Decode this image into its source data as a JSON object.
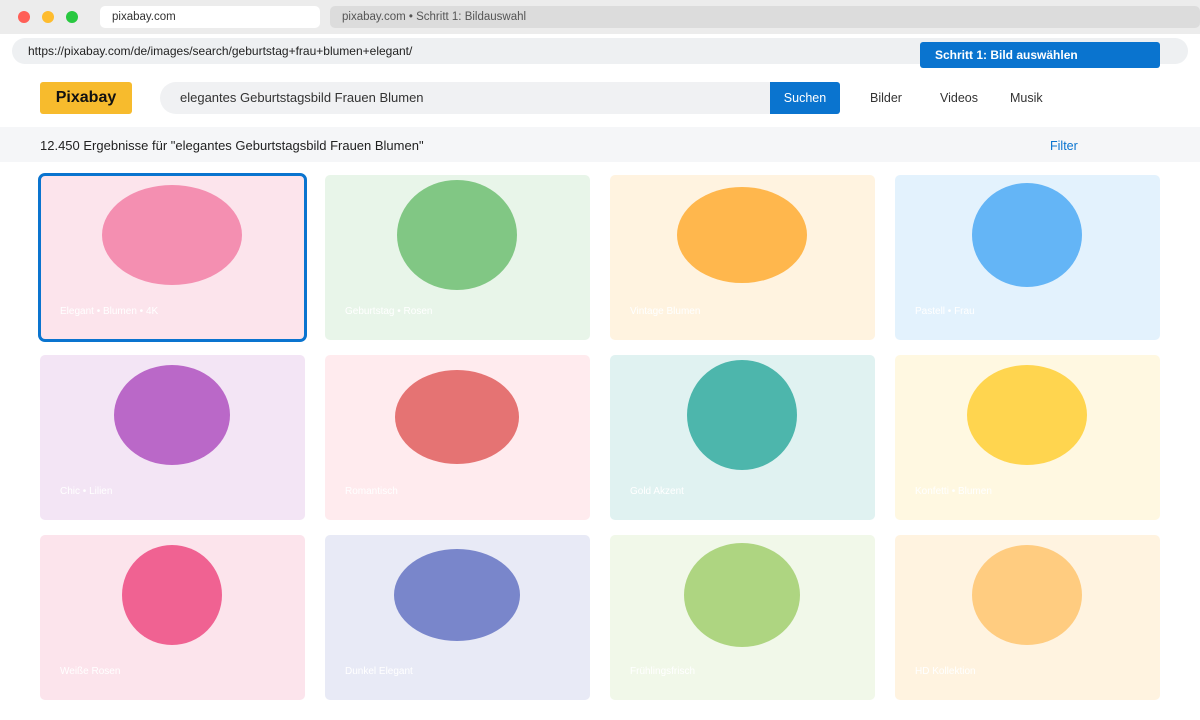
{
  "browser": {
    "active_tab": "pixabay.com",
    "inactive_tab": "pixabay.com • Schritt 1: Bildauswahl",
    "url": "https://pixabay.com/de/images/search/geburtstag+frau+blumen+elegant/"
  },
  "banner": {
    "step_label": "Schritt 1: Bild auswählen"
  },
  "header": {
    "logo": "Pixabay",
    "search_value": "elegantes Geburtstagsbild Frauen Blumen",
    "search_button": "Suchen",
    "nav": [
      "Bilder",
      "Videos",
      "Musik"
    ]
  },
  "results": {
    "count_text": "12.450 Ergebnisse für \"elegantes Geburtstagsbild Frauen Blumen\"",
    "filter_label": "Filter"
  },
  "images": [
    {
      "caption": "Elegant • Blumen • 4K",
      "bg": "#fce4ec",
      "accent": "#f48fb1",
      "selected": true
    },
    {
      "caption": "Geburtstag • Rosen",
      "bg": "#e8f5e9",
      "accent": "#81c784",
      "selected": false
    },
    {
      "caption": "Vintage Blumen",
      "bg": "#fff3e0",
      "accent": "#ffb74d",
      "selected": false
    },
    {
      "caption": "Pastell • Frau",
      "bg": "#e3f2fd",
      "accent": "#64b5f6",
      "selected": false
    },
    {
      "caption": "Chic • Lilien",
      "bg": "#f3e5f5",
      "accent": "#ba68c8",
      "selected": false
    },
    {
      "caption": "Romantisch",
      "bg": "#ffebee",
      "accent": "#e57373",
      "selected": false
    },
    {
      "caption": "Gold Akzent",
      "bg": "#e0f2f1",
      "accent": "#4db6ac",
      "selected": false
    },
    {
      "caption": "Konfetti • Blumen",
      "bg": "#fff8e1",
      "accent": "#ffd54f",
      "selected": false
    },
    {
      "caption": "Weiße Rosen",
      "bg": "#fce4ec",
      "accent": "#f06292",
      "selected": false
    },
    {
      "caption": "Dunkel Elegant",
      "bg": "#e8eaf6",
      "accent": "#7986cb",
      "selected": false
    },
    {
      "caption": "Frühlingsfrisch",
      "bg": "#f1f8e9",
      "accent": "#aed581",
      "selected": false
    },
    {
      "caption": "HD Kollektion",
      "bg": "#fff3e0",
      "accent": "#ffcc80",
      "selected": false
    }
  ]
}
